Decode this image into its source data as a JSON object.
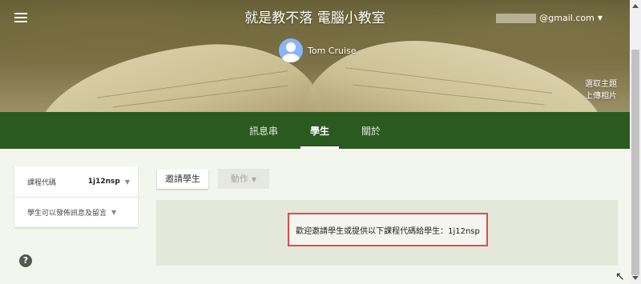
{
  "header": {
    "class_title": "就是教不落 電腦小教室",
    "account_email": "@gmail.com",
    "teacher_name": "Tom Cruise",
    "select_theme": "選取主題",
    "upload_photo": "上傳相片"
  },
  "tabs": [
    {
      "label": "訊息串",
      "active": false
    },
    {
      "label": "學生",
      "active": true
    },
    {
      "label": "關於",
      "active": false
    }
  ],
  "sidebar": {
    "class_code_label": "課程代碼",
    "class_code_value": "1j12nsp",
    "permission_label": "學生可以發佈訊息及留言"
  },
  "toolbar": {
    "invite_label": "邀請學生",
    "actions_label": "動作"
  },
  "main": {
    "welcome_text": "歡迎邀請學生或提供以下課程代碼給學生：1j12nsp"
  },
  "help": {
    "label": "?"
  },
  "colors": {
    "tab_bar": "#2b5a20",
    "highlight_border": "#dd4b4b",
    "page_bg": "#f3f6ec"
  }
}
